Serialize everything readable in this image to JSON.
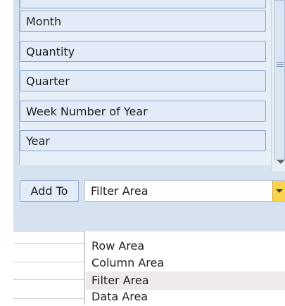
{
  "field_list": {
    "items": [
      {
        "label": ""
      },
      {
        "label": "Month"
      },
      {
        "label": "Quantity"
      },
      {
        "label": "Quarter"
      },
      {
        "label": "Week Number of Year"
      },
      {
        "label": "Year"
      }
    ]
  },
  "add_to": {
    "button_label": "Add To",
    "selected_value": "Filter Area"
  },
  "dropdown": {
    "options": [
      {
        "label": "Row Area",
        "selected": false
      },
      {
        "label": "Column Area",
        "selected": false
      },
      {
        "label": "Filter Area",
        "selected": true
      },
      {
        "label": "Data Area",
        "selected": false
      }
    ]
  }
}
